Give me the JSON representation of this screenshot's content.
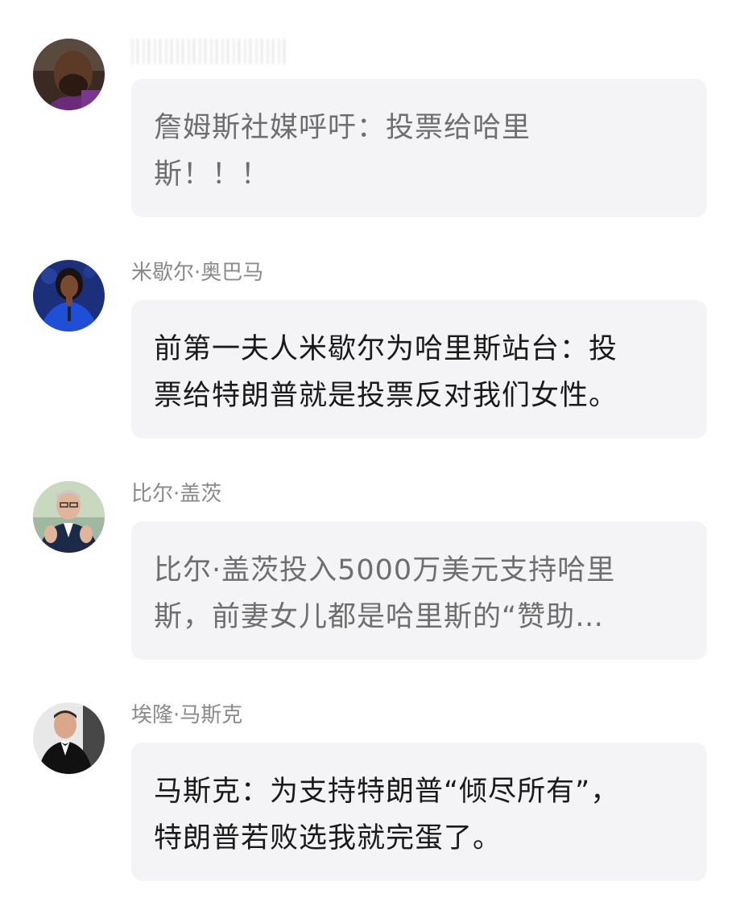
{
  "messages": [
    {
      "sender": "",
      "lines": [
        "詹姆斯社媒呼吁：投票给哈里",
        "斯！！！"
      ],
      "muted": true,
      "avatar_icon": "avatar-lebron-icon"
    },
    {
      "sender": "米歇尔·奥巴马",
      "lines": [
        "前第一夫人米歇尔为哈里斯站台：投",
        "票给特朗普就是投票反对我们女性。"
      ],
      "muted": false,
      "avatar_icon": "avatar-michelle-icon"
    },
    {
      "sender": "比尔·盖茨",
      "lines": [
        "比尔·盖茨投入5000万美元支持哈里",
        "斯，前妻女儿都是哈里斯的“赞助…"
      ],
      "muted": true,
      "avatar_icon": "avatar-bill-icon"
    },
    {
      "sender": "埃隆·马斯克",
      "lines": [
        "马斯克：为支持特朗普“倾尽所有”，",
        "特朗普若败选我就完蛋了。"
      ],
      "muted": false,
      "avatar_icon": "avatar-elon-icon"
    }
  ],
  "colors": {
    "bubble_bg": "#f4f4f6",
    "sender_text": "#8a8a8a",
    "text_dark": "#1a1a1a",
    "text_muted": "#6e6e6e"
  }
}
